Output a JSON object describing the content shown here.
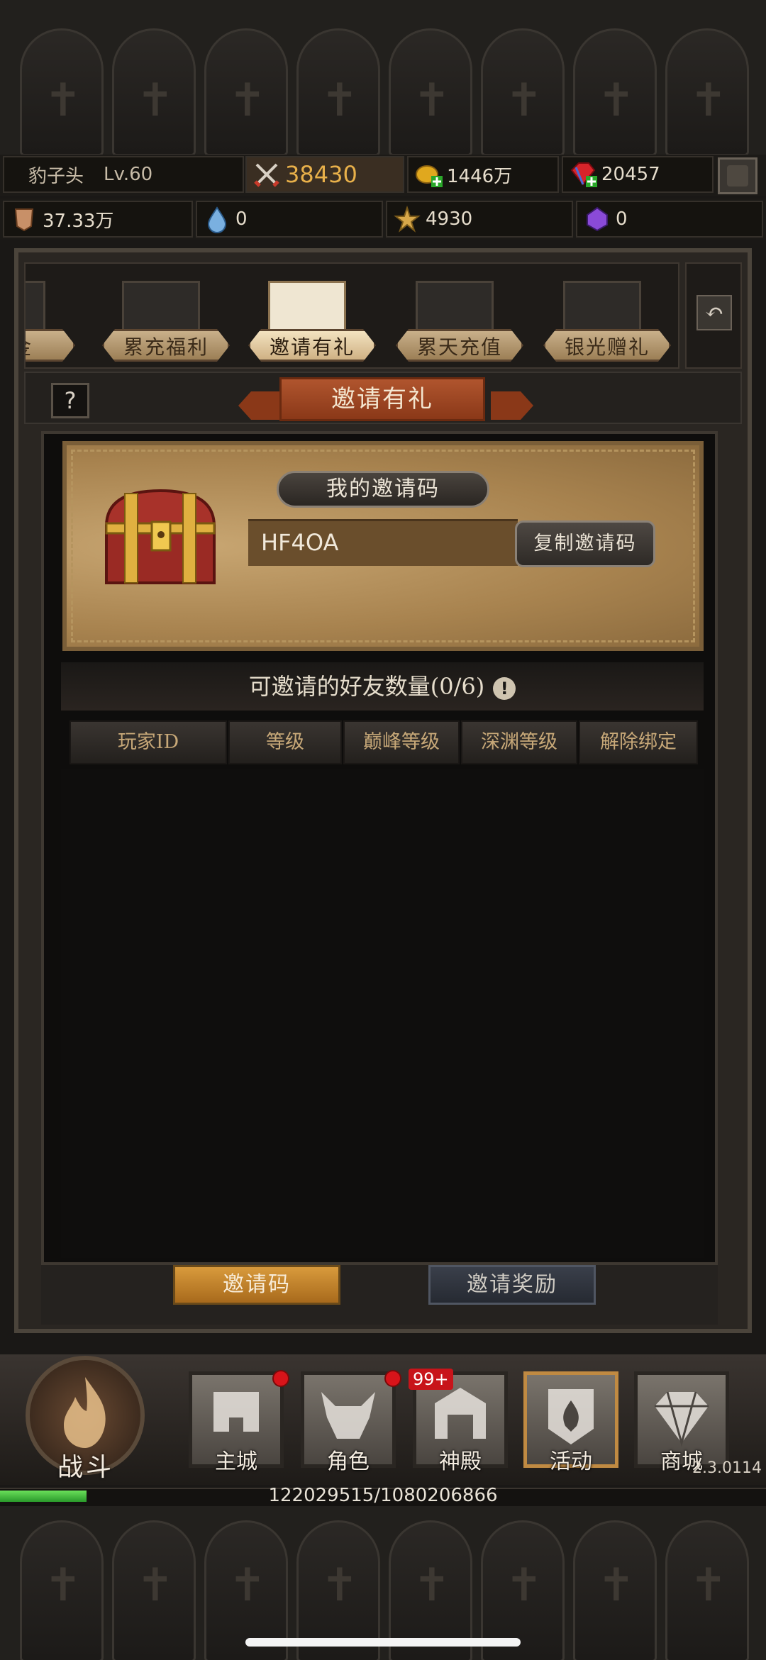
{
  "header": {
    "player_name": "豹子头",
    "level": "Lv.60",
    "power": "38430",
    "gold": "1446万",
    "gems": "20457"
  },
  "resources": {
    "defense": "37.33万",
    "mana": "0",
    "soul": "4930",
    "crystal": "0"
  },
  "tabs": [
    {
      "label": "基金",
      "active": false
    },
    {
      "label": "累充福利",
      "active": false
    },
    {
      "label": "邀请有礼",
      "active": true
    },
    {
      "label": "累天充值",
      "active": false
    },
    {
      "label": "银光赠礼",
      "active": false
    }
  ],
  "page_title": "邀请有礼",
  "help_label": "?",
  "invite": {
    "label": "我的邀请码",
    "code": "HF4OA",
    "copy_label": "复制邀请码"
  },
  "friends": {
    "title": "可邀请的好友数量(0/6)",
    "info_glyph": "!",
    "columns": [
      "玩家ID",
      "等级",
      "巅峰等级",
      "深渊等级",
      "解除绑定"
    ]
  },
  "bottom_buttons": {
    "invite_code": "邀请码",
    "invite_reward": "邀请奖励"
  },
  "nav": {
    "fight": "战斗",
    "items": [
      {
        "label": "主城",
        "dot": true
      },
      {
        "label": "角色",
        "dot": true
      },
      {
        "label": "神殿",
        "badge": "99+"
      },
      {
        "label": "活动",
        "active": true
      },
      {
        "label": "商城"
      }
    ],
    "version": "2.3.0114"
  },
  "xp": {
    "text": "122029515/1080206866",
    "fraction": 0.113
  },
  "colors": {
    "accent_orange": "#d89a3c",
    "badge_red": "#c8141a",
    "xp_green": "#4ac83a"
  }
}
